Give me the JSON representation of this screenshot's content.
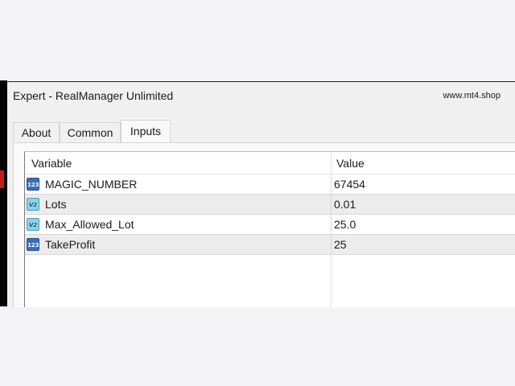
{
  "window": {
    "title": "Expert - RealManager Unlimited",
    "brand": "www.mt4.shop"
  },
  "tabs": [
    {
      "label": "About",
      "active": false
    },
    {
      "label": "Common",
      "active": false
    },
    {
      "label": "Inputs",
      "active": true
    }
  ],
  "table": {
    "headers": {
      "variable": "Variable",
      "value": "Value"
    },
    "rows": [
      {
        "icon": "int-type-icon",
        "icon_text": "123",
        "name": "MAGIC_NUMBER",
        "value": "67454"
      },
      {
        "icon": "double-type-icon",
        "icon_text": "V2",
        "name": "Lots",
        "value": "0.01"
      },
      {
        "icon": "double-type-icon",
        "icon_text": "V2",
        "name": "Max_Allowed_Lot",
        "value": "25.0"
      },
      {
        "icon": "int-type-icon",
        "icon_text": "123",
        "name": "TakeProfit",
        "value": "25"
      }
    ]
  },
  "colors": {
    "int_icon": "#3a6fb3",
    "double_icon": "#8fd0e8",
    "chart_mark": "#c81c1c"
  }
}
